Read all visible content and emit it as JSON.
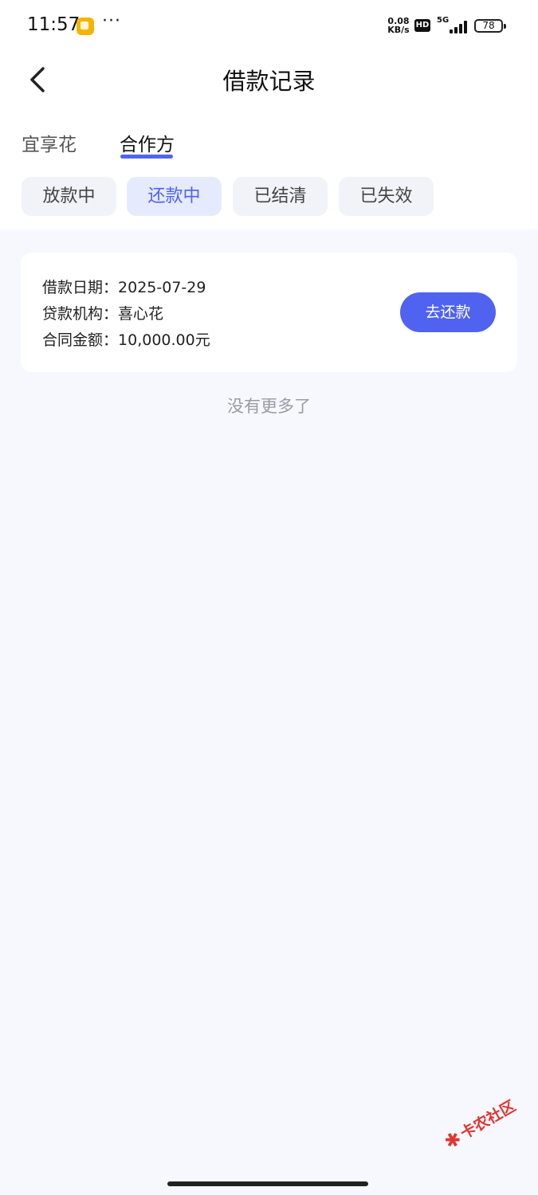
{
  "status_bar": {
    "time": "11:57",
    "more": "···",
    "net_speed_value": "0.08",
    "net_speed_unit": "KB/s",
    "hd": "HD",
    "network": "5G",
    "battery": "78"
  },
  "header": {
    "title": "借款记录",
    "back_icon": "chevron-left-icon"
  },
  "top_tabs": [
    {
      "label": "宜享花",
      "active": false
    },
    {
      "label": "合作方",
      "active": true
    }
  ],
  "filter_chips": [
    {
      "label": "放款中",
      "active": false
    },
    {
      "label": "还款中",
      "active": true
    },
    {
      "label": "已结清",
      "active": false
    },
    {
      "label": "已失效",
      "active": false
    }
  ],
  "record": {
    "loan_date_label": "借款日期：",
    "loan_date": "2025-07-29",
    "lender_label": "贷款机构：",
    "lender": "喜心花",
    "amount_label": "合同金额：",
    "amount": "10,000.00元",
    "repay_button": "去还款"
  },
  "no_more_text": "没有更多了",
  "watermark": "卡农社区",
  "colors": {
    "accent": "#4f63f0",
    "background": "#f7f8fd",
    "chip_bg": "#f2f3f8",
    "chip_active_bg": "#e6eafd"
  }
}
